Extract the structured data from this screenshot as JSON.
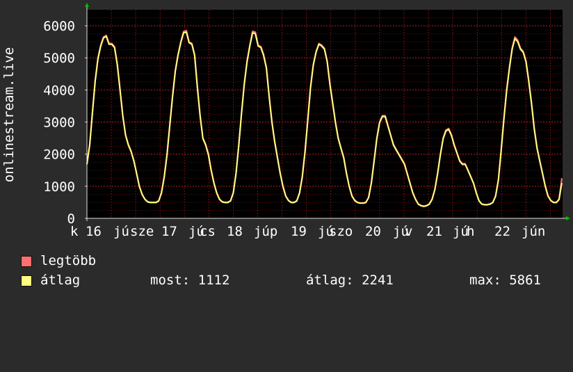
{
  "chart_data": {
    "type": "line",
    "ylabel": "onlinestream.live",
    "ylim": [
      0,
      6500
    ],
    "yticks": [
      0,
      1000,
      2000,
      3000,
      4000,
      5000,
      6000
    ],
    "grid": true,
    "background": "#000000",
    "grid_color": "#8a1a1a",
    "axis_arrow_color": "#00c000",
    "x_tick_labels": [
      "k",
      "16",
      "jú",
      "sze",
      "17",
      "jú",
      "cs",
      "18",
      "júp",
      "19",
      "jú",
      "szo",
      "20",
      "jú",
      "v",
      "21",
      "jú",
      "h",
      "22",
      "jún"
    ],
    "series": [
      {
        "name": "legtöbb",
        "color": "#ff7070",
        "values": [
          1700,
          2300,
          3300,
          4300,
          5000,
          5400,
          5650,
          5700,
          5450,
          5450,
          5350,
          4800,
          4000,
          3200,
          2600,
          2300,
          2100,
          1800,
          1400,
          1000,
          750,
          600,
          520,
          500,
          500,
          500,
          550,
          800,
          1300,
          2000,
          2900,
          3800,
          4600,
          5100,
          5500,
          5820,
          5850,
          5500,
          5450,
          5100,
          4100,
          3200,
          2500,
          2300,
          2000,
          1500,
          1100,
          800,
          600,
          520,
          500,
          500,
          550,
          800,
          1400,
          2300,
          3300,
          4200,
          4900,
          5400,
          5830,
          5800,
          5400,
          5350,
          5100,
          4700,
          3800,
          3000,
          2400,
          1900,
          1400,
          1000,
          700,
          560,
          500,
          500,
          550,
          800,
          1300,
          2100,
          3100,
          4100,
          4800,
          5200,
          5450,
          5400,
          5300,
          4900,
          4200,
          3600,
          3000,
          2500,
          2200,
          1900,
          1400,
          1000,
          700,
          560,
          500,
          480,
          480,
          500,
          650,
          1100,
          1800,
          2500,
          3000,
          3200,
          3200,
          2900,
          2600,
          2300,
          2150,
          2000,
          1850,
          1700,
          1400,
          1100,
          800,
          600,
          450,
          400,
          380,
          400,
          450,
          600,
          900,
          1400,
          2000,
          2500,
          2750,
          2800,
          2600,
          2300,
          2050,
          1800,
          1700,
          1700,
          1500,
          1300,
          1100,
          800,
          550,
          450,
          430,
          430,
          450,
          500,
          700,
          1200,
          2100,
          3100,
          4000,
          4700,
          5300,
          5650,
          5550,
          5300,
          5200,
          4900,
          4300,
          3600,
          2800,
          2200,
          1800,
          1400,
          1000,
          700,
          560,
          500,
          500,
          600,
          1250
        ]
      },
      {
        "name": "átlag",
        "color": "#ffff80",
        "values": [
          1680,
          2280,
          3270,
          4270,
          4970,
          5370,
          5620,
          5670,
          5420,
          5420,
          5320,
          4780,
          3980,
          3180,
          2580,
          2280,
          2080,
          1780,
          1390,
          990,
          740,
          590,
          510,
          490,
          490,
          490,
          540,
          790,
          1290,
          1980,
          2880,
          3780,
          4580,
          5080,
          5470,
          5780,
          5800,
          5470,
          5420,
          5070,
          4080,
          3180,
          2480,
          2280,
          1980,
          1490,
          1090,
          790,
          590,
          510,
          490,
          490,
          540,
          790,
          1390,
          2280,
          3280,
          4180,
          4880,
          5370,
          5780,
          5750,
          5370,
          5320,
          5070,
          4680,
          3780,
          2980,
          2380,
          1880,
          1390,
          990,
          690,
          550,
          490,
          490,
          540,
          790,
          1290,
          2080,
          3080,
          4080,
          4780,
          5180,
          5420,
          5370,
          5270,
          4880,
          4180,
          3580,
          2980,
          2480,
          2180,
          1880,
          1390,
          990,
          690,
          550,
          490,
          470,
          470,
          490,
          640,
          1090,
          1780,
          2480,
          2980,
          3170,
          3170,
          2880,
          2580,
          2280,
          2130,
          1980,
          1830,
          1680,
          1390,
          1090,
          790,
          590,
          440,
          390,
          370,
          390,
          440,
          590,
          890,
          1390,
          1980,
          2480,
          2720,
          2770,
          2580,
          2280,
          2030,
          1780,
          1680,
          1680,
          1490,
          1290,
          1090,
          790,
          540,
          440,
          420,
          420,
          440,
          490,
          690,
          1190,
          2080,
          3080,
          3980,
          4680,
          5270,
          5600,
          5500,
          5270,
          5170,
          4880,
          4280,
          3580,
          2780,
          2180,
          1780,
          1390,
          990,
          690,
          550,
          490,
          490,
          590,
          1100
        ]
      }
    ]
  },
  "legend": {
    "items": [
      {
        "label": "legtöbb",
        "color": "#ff7070"
      },
      {
        "label": "átlag",
        "color": "#ffff80"
      }
    ],
    "stats": {
      "now": "most: 1112",
      "avg": "átlag: 2241",
      "max": "max: 5861"
    }
  }
}
